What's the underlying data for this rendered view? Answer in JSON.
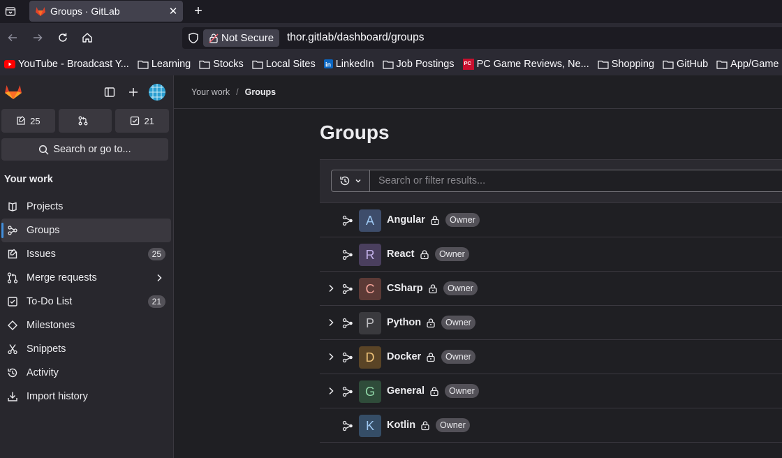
{
  "browser": {
    "tab_title": "Groups · GitLab",
    "not_secure_label": "Not Secure",
    "url": "thor.gitlab/dashboard/groups",
    "bookmarks": [
      {
        "label": "YouTube - Broadcast Y...",
        "icon": "youtube-icon"
      },
      {
        "label": "Learning",
        "icon": "folder-icon"
      },
      {
        "label": "Stocks",
        "icon": "folder-icon"
      },
      {
        "label": "Local Sites",
        "icon": "folder-icon"
      },
      {
        "label": "LinkedIn",
        "icon": "linkedin-icon"
      },
      {
        "label": "Job Postings",
        "icon": "folder-icon"
      },
      {
        "label": "PC Game Reviews, Ne...",
        "icon": "pcgamer-icon"
      },
      {
        "label": "Shopping",
        "icon": "folder-icon"
      },
      {
        "label": "GitHub",
        "icon": "folder-icon"
      },
      {
        "label": "App/Game",
        "icon": "folder-icon"
      }
    ]
  },
  "sidebar": {
    "counters": {
      "issues": "25",
      "merge_requests": "",
      "todos": "21"
    },
    "search_label": "Search or go to...",
    "section_title": "Your work",
    "items": [
      {
        "label": "Projects",
        "icon": "project-icon"
      },
      {
        "label": "Groups",
        "icon": "group-icon",
        "active": true
      },
      {
        "label": "Issues",
        "icon": "issues-icon",
        "badge": "25"
      },
      {
        "label": "Merge requests",
        "icon": "merge-request-icon"
      },
      {
        "label": "To-Do List",
        "icon": "todo-icon",
        "badge": "21"
      },
      {
        "label": "Milestones",
        "icon": "milestone-icon"
      },
      {
        "label": "Snippets",
        "icon": "snippet-icon"
      },
      {
        "label": "Activity",
        "icon": "history-icon"
      },
      {
        "label": "Import history",
        "icon": "import-icon"
      }
    ]
  },
  "breadcrumb": {
    "parent": "Your work",
    "current": "Groups"
  },
  "main": {
    "title": "Groups",
    "filter_placeholder": "Search or filter results..."
  },
  "groups": [
    {
      "name": "Angular",
      "letter": "A",
      "role": "Owner",
      "expandable": false,
      "color": "#3e4d6b",
      "letter_color": "#9dc7f1"
    },
    {
      "name": "React",
      "letter": "R",
      "role": "Owner",
      "expandable": false,
      "color": "#4a3f5e",
      "letter_color": "#c5b3ec"
    },
    {
      "name": "CSharp",
      "letter": "C",
      "role": "Owner",
      "expandable": true,
      "color": "#5c3a36",
      "letter_color": "#f5a49a"
    },
    {
      "name": "Python",
      "letter": "P",
      "role": "Owner",
      "expandable": true,
      "color": "#3a3a3e",
      "letter_color": "#bfbfc3"
    },
    {
      "name": "Docker",
      "letter": "D",
      "role": "Owner",
      "expandable": true,
      "color": "#5a4426",
      "letter_color": "#f0c47a"
    },
    {
      "name": "General",
      "letter": "G",
      "role": "Owner",
      "expandable": true,
      "color": "#2f4c3a",
      "letter_color": "#8fd5a6"
    },
    {
      "name": "Kotlin",
      "letter": "K",
      "role": "Owner",
      "expandable": false,
      "color": "#354d66",
      "letter_color": "#9dc7f1"
    }
  ]
}
